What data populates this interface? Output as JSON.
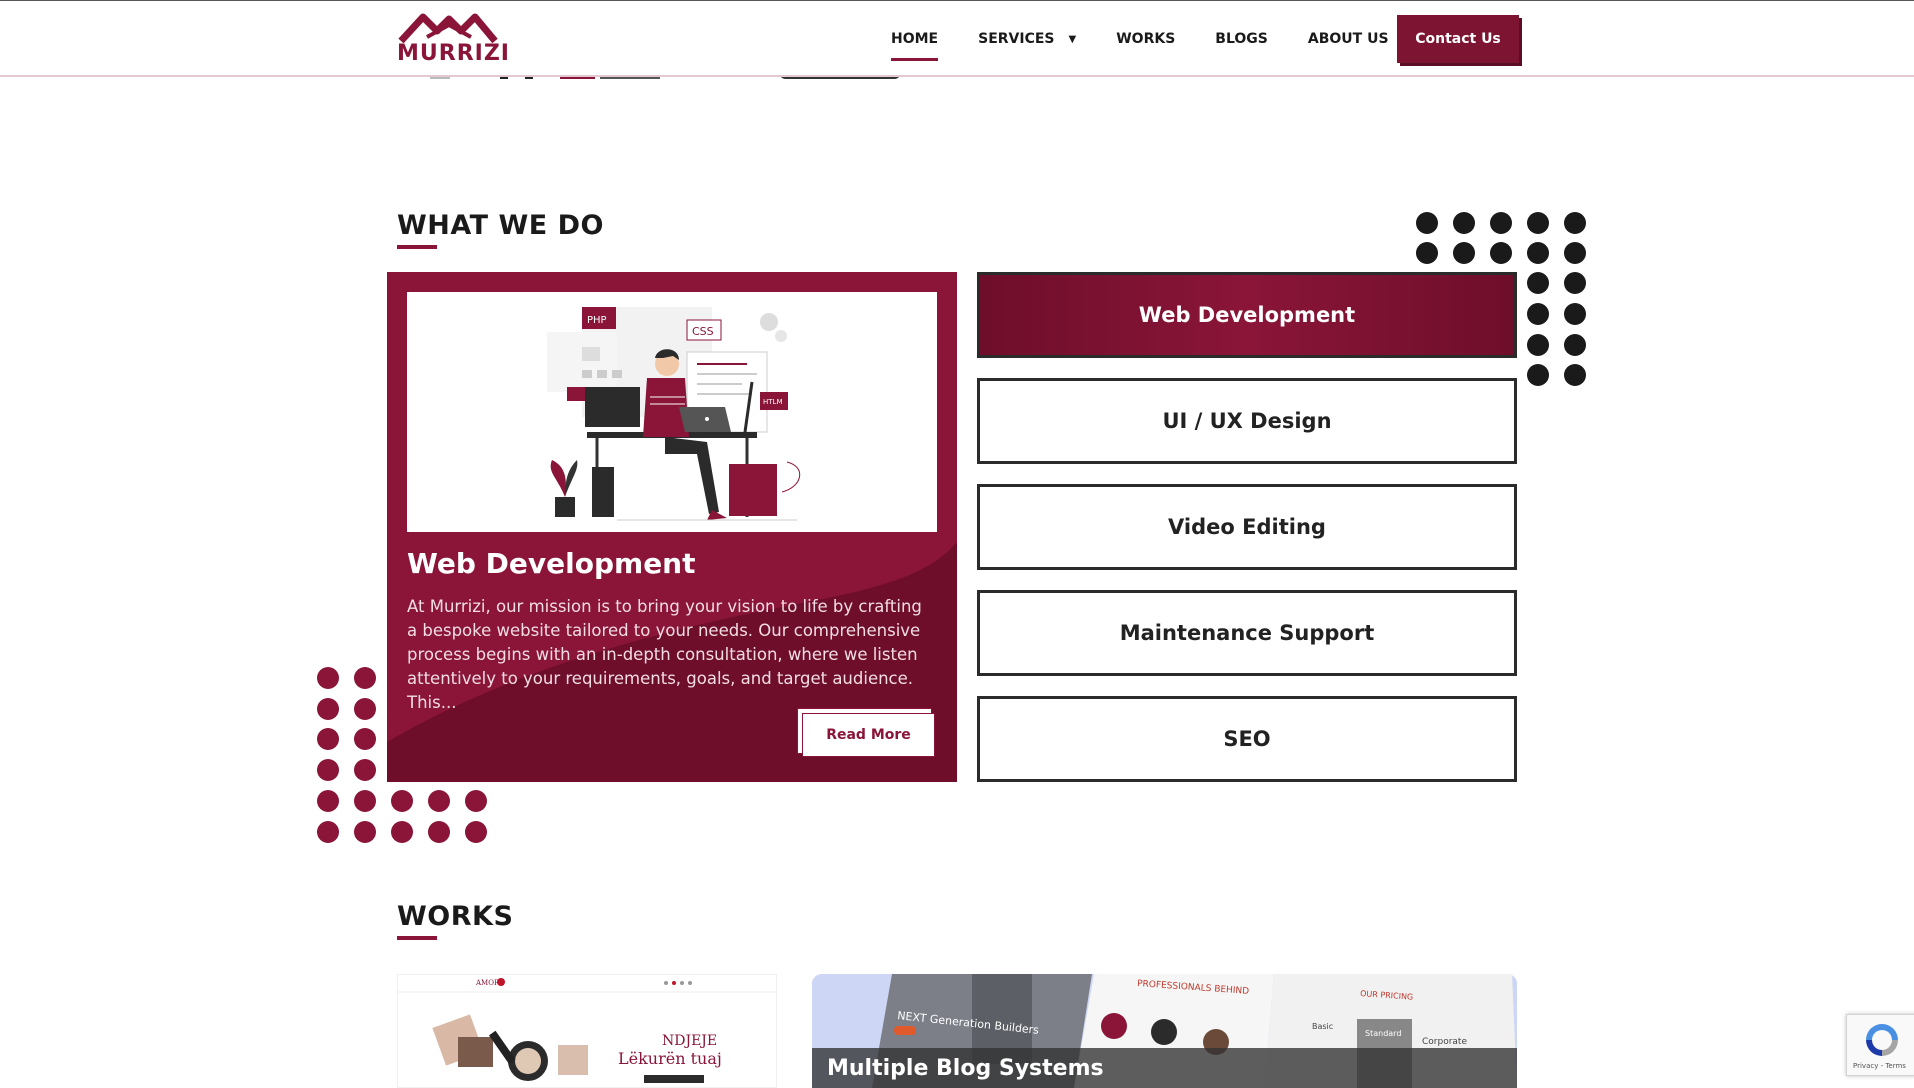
{
  "header": {
    "logo_text": "MURRIZI",
    "nav": [
      {
        "label": "HOME"
      },
      {
        "label": "SERVICES"
      },
      {
        "label": "WORKS"
      },
      {
        "label": "BLOGS"
      },
      {
        "label": "ABOUT US"
      }
    ],
    "contact_label": "Contact Us"
  },
  "what_we_do": {
    "title": "WHAT WE DO",
    "card": {
      "title": "Web Development",
      "description": "At Murrizi, our mission is to bring your vision to life by crafting a bespoke website tailored to your needs. Our comprehensive process begins with an in-depth consultation, where we listen attentively to your requirements, goals, and target audience. This...",
      "read_more": "Read More",
      "image_tags": {
        "php": "PHP",
        "css": "CSS",
        "html": "HTLM"
      }
    },
    "tabs": [
      {
        "label": "Web Development",
        "active": true
      },
      {
        "label": "UI / UX Design",
        "active": false
      },
      {
        "label": "Video Editing",
        "active": false
      },
      {
        "label": "Maintenance Support",
        "active": false
      },
      {
        "label": "SEO",
        "active": false
      }
    ]
  },
  "works": {
    "title": "WORKS",
    "item1": {
      "brand": "AMORE",
      "text_line1": "NDJEJE",
      "text_line2": "Lëkurën tuaj"
    },
    "item2": {
      "title": "Multiple Blog Systems",
      "screen_text_1": "NEXT Generation Builders",
      "screen_text_2": "PROFESSIONALS BEHIND",
      "screen_text_3": "OUR PRICING",
      "plan_1": "Basic",
      "plan_2": "Standard",
      "plan_3": "Corporate"
    }
  },
  "recaptcha": {
    "footer": "Privacy - Terms"
  },
  "colors": {
    "brand": "#8a1538",
    "dark_dots": "#1a1a1a"
  }
}
